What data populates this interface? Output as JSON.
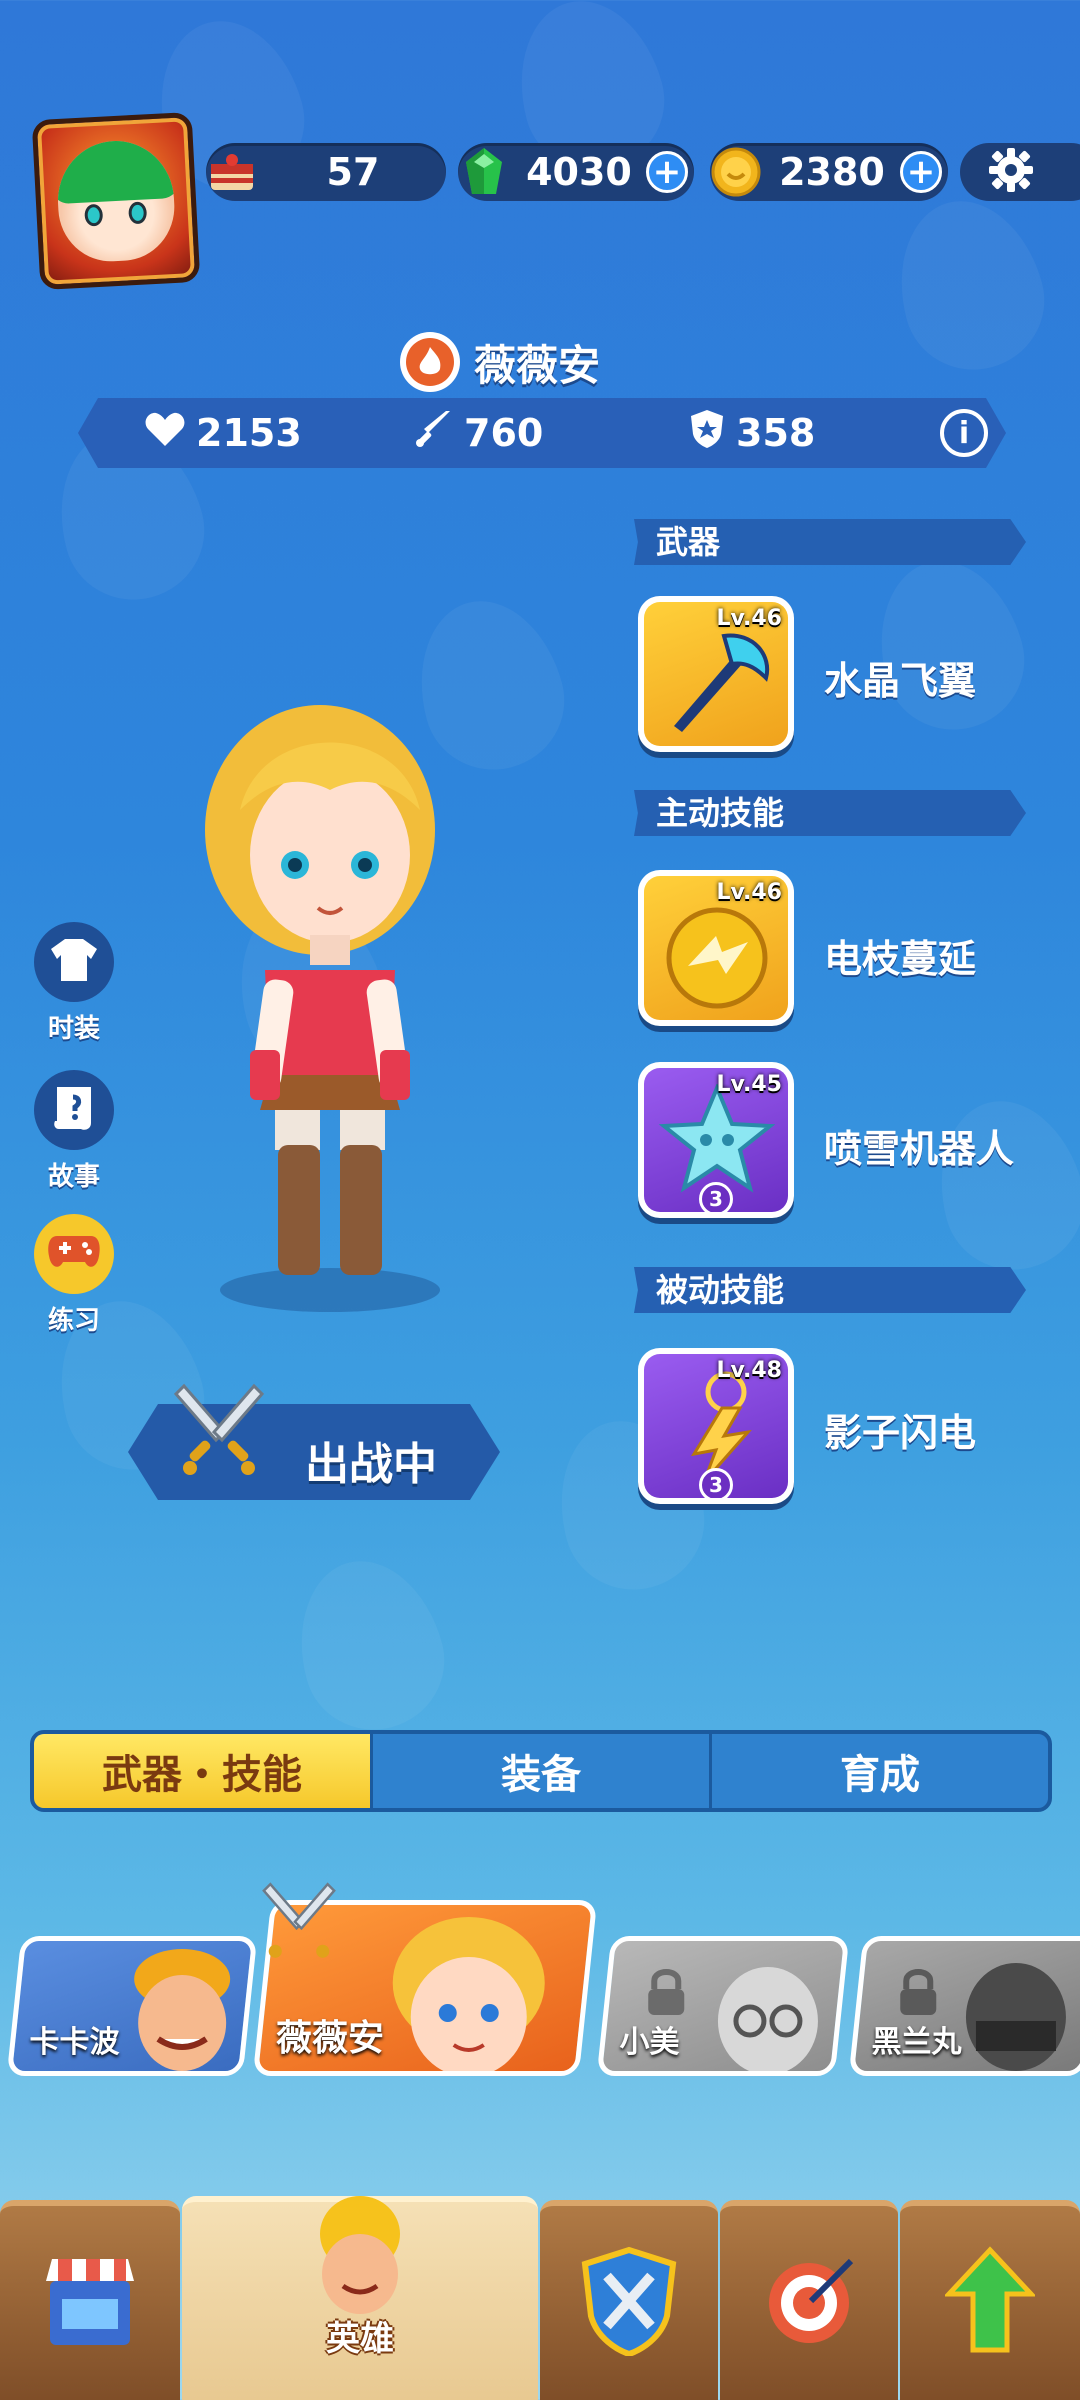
{
  "resources": {
    "stamina": "57",
    "gems": "4030",
    "coins": "2380"
  },
  "hero": {
    "name": "薇薇安",
    "hp": "2153",
    "attack": "760",
    "defense": "358",
    "deploy_status": "出战中"
  },
  "sections": {
    "weapon": "武器",
    "active_skill": "主动技能",
    "passive_skill": "被动技能"
  },
  "skills": [
    {
      "level": "Lv.46",
      "name": "水晶飞翼"
    },
    {
      "level": "Lv.46",
      "name": "电枝蔓延"
    },
    {
      "level": "Lv.45",
      "name": "喷雪机器人",
      "badge": "3"
    },
    {
      "level": "Lv.48",
      "name": "影子闪电",
      "badge": "3"
    }
  ],
  "side_buttons": [
    "时装",
    "故事",
    "练习"
  ],
  "tabs": [
    "武器・技能",
    "装备",
    "育成"
  ],
  "hero_roster": [
    {
      "name": "卡卡波",
      "locked": false
    },
    {
      "name": "薇薇安",
      "locked": false,
      "selected": true
    },
    {
      "name": "小美",
      "locked": true
    },
    {
      "name": "黑兰丸",
      "locked": true
    }
  ],
  "bottom_nav": {
    "active_label": "英雄"
  },
  "colors": {
    "accent_yellow": "#f6c82b",
    "panel_blue": "#1d3f78",
    "hero_orange": "#f07a22"
  }
}
